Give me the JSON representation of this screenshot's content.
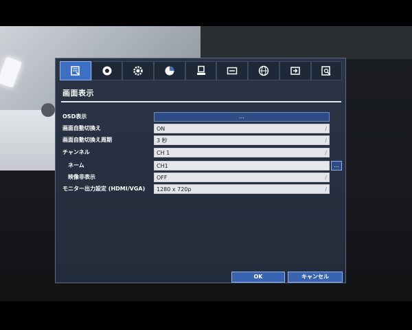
{
  "tabs": [
    {
      "icon": "display-settings-icon",
      "active": true
    },
    {
      "icon": "record-disc-icon",
      "active": false
    },
    {
      "icon": "gear-icon",
      "active": false
    },
    {
      "icon": "schedule-chart-icon",
      "active": false
    },
    {
      "icon": "network-computer-icon",
      "active": false
    },
    {
      "icon": "storage-drive-icon",
      "active": false
    },
    {
      "icon": "globe-icon",
      "active": false
    },
    {
      "icon": "export-icon",
      "active": false
    },
    {
      "icon": "search-log-icon",
      "active": false
    }
  ],
  "section_title": "画面表示",
  "rows": {
    "osd": {
      "label": "OSD表示",
      "button": "..."
    },
    "auto_switch": {
      "label": "画面自動切換え",
      "value": "ON"
    },
    "auto_interval": {
      "label": "画面自動切換え周期",
      "value": "3 秒"
    },
    "channel": {
      "label": "チャンネル",
      "value": "CH 1"
    },
    "name": {
      "label": "ネーム",
      "value": "CH1",
      "button": "..."
    },
    "hide_video": {
      "label": "映像非表示",
      "value": "OFF"
    },
    "monitor_output": {
      "label": "モニター出力設定 (HDMI/VGA)",
      "value": "1280 x 720p"
    }
  },
  "footer": {
    "ok": "OK",
    "cancel": "キャンセル"
  },
  "colors": {
    "accent": "#3d6fc4",
    "panel": "#263040"
  }
}
